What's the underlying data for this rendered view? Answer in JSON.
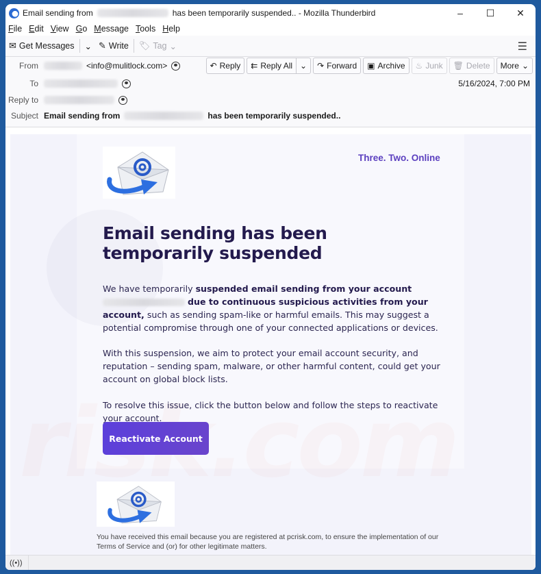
{
  "window": {
    "title_prefix": "Email sending from",
    "title_suffix": "has been temporarily suspended.. - Mozilla Thunderbird",
    "controls": {
      "minimize": "–",
      "maximize": "☐",
      "close": "✕"
    }
  },
  "menu": [
    {
      "key": "F",
      "rest": "ile"
    },
    {
      "key": "E",
      "rest": "dit"
    },
    {
      "key": "V",
      "rest": "iew"
    },
    {
      "key": "G",
      "rest": "o"
    },
    {
      "key": "M",
      "rest": "essage"
    },
    {
      "key": "T",
      "rest": "ools"
    },
    {
      "key": "H",
      "rest": "elp"
    }
  ],
  "toolbar": {
    "get_messages": "Get Messages",
    "write": "Write",
    "tag": "Tag"
  },
  "header": {
    "labels": {
      "from": "From",
      "to": "To",
      "reply_to": "Reply to",
      "subject": "Subject"
    },
    "from_email": "<info@mulitlock.com>",
    "subject_prefix": "Email sending from",
    "subject_suffix": "has been temporarily suspended..",
    "date": "5/16/2024, 7:00 PM",
    "actions": {
      "reply": "Reply",
      "reply_all": "Reply All",
      "forward": "Forward",
      "archive": "Archive",
      "junk": "Junk",
      "delete": "Delete",
      "more": "More"
    }
  },
  "email": {
    "brand": "Three. Two. Online",
    "headline": "Email sending has been temporarily suspended",
    "p1_a": "We have temporarily ",
    "p1_bold1": "suspended email sending from your account",
    "p1_bold2": "due to continuous suspicious activities from your account,",
    "p1_b": " such as sending spam-like or harmful emails. This may suggest a potential compromise through one of your connected applications or devices.",
    "p2": "With this suspension, we aim to protect your email account security, and reputation – sending spam, malware, or other harmful content, could get your account on global block lists.",
    "p3": "To resolve this issue, click the button below and follow the steps to reactivate your account.",
    "cta": "Reactivate Account",
    "footer": "You have received this email because you are registered at pcrisk.com, to ensure the implementation of our Terms of Service and (or) for other legitimate matters.",
    "watermark": "risk.com",
    "accent_color": "#5b3fdb",
    "brand_color": "#5b3fbf"
  },
  "status": {
    "icon": "((•))"
  }
}
